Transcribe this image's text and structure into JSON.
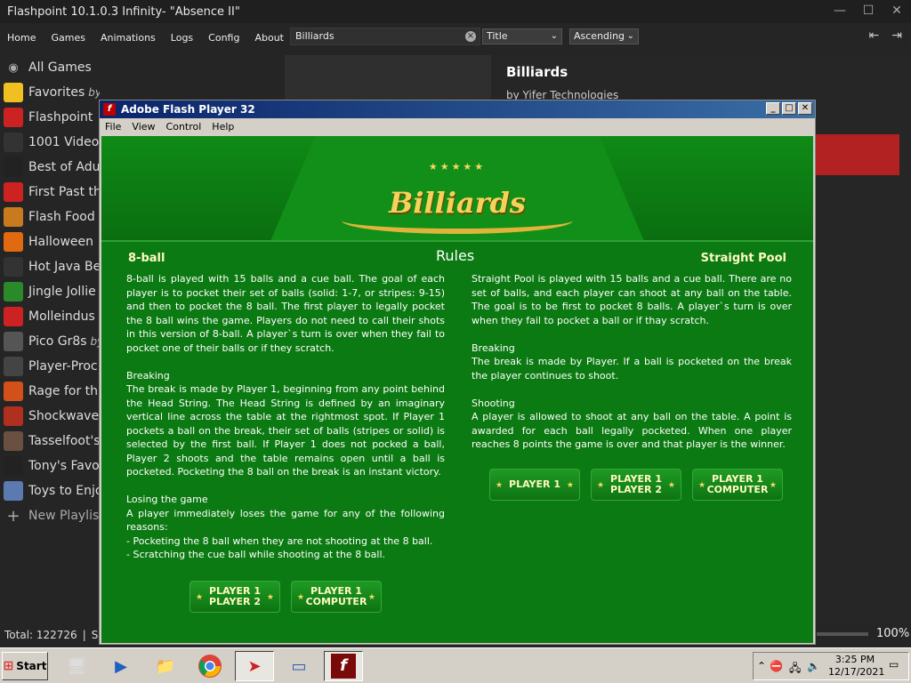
{
  "window": {
    "title": "Flashpoint 10.1.0.3 Infinity- \"Absence II\"",
    "min": "—",
    "max": "☐",
    "close": "✕"
  },
  "nav": {
    "items": [
      "Home",
      "Games",
      "Animations",
      "Logs",
      "Config",
      "About"
    ]
  },
  "search": {
    "value": "Billiards"
  },
  "sort": {
    "field": "Title",
    "order": "Ascending"
  },
  "sidebar": {
    "all_games": "All Games",
    "items": [
      {
        "label": "Favorites",
        "sub": "by You!",
        "icon": "star-icon",
        "color": "#f0c020"
      },
      {
        "label": "Flashpoint",
        "icon": "flashpoint-icon",
        "color": "#c22"
      },
      {
        "label": "1001 Video",
        "icon": "invader-icon",
        "color": "#333"
      },
      {
        "label": "Best of Adu",
        "icon": "as-icon",
        "color": "#222"
      },
      {
        "label": "First Past th",
        "icon": "number-one-icon",
        "color": "#c22"
      },
      {
        "label": "Flash Food",
        "icon": "burger-icon",
        "color": "#c87a1e"
      },
      {
        "label": "Halloween",
        "icon": "pumpkin-icon",
        "color": "#e06a10"
      },
      {
        "label": "Hot Java Be",
        "icon": "coffee-icon",
        "color": "#333"
      },
      {
        "label": "Jingle Jollie",
        "icon": "tree-icon",
        "color": "#2a8a2a"
      },
      {
        "label": "Molleindus",
        "icon": "mollein-icon",
        "color": "#c22"
      },
      {
        "label": "Pico Gr8s",
        "sub": "by",
        "icon": "pixel-icon",
        "color": "#555"
      },
      {
        "label": "Player-Proc",
        "icon": "share-icon",
        "color": "#444"
      },
      {
        "label": "Rage for th",
        "icon": "fire-icon",
        "color": "#d4501a"
      },
      {
        "label": "Shockwave",
        "icon": "shockwave-icon",
        "color": "#b03020"
      },
      {
        "label": "Tasselfoot's",
        "icon": "avatar-icon",
        "color": "#6a5040"
      },
      {
        "label": "Tony's Favo",
        "icon": "figure-icon",
        "color": "#222"
      },
      {
        "label": "Toys to Enjo",
        "icon": "toys-icon",
        "color": "#5a7ab0"
      }
    ],
    "new_playlist": "New Playlis"
  },
  "detail": {
    "title": "Billiards",
    "by": "by Yifer Technologies"
  },
  "status": {
    "total": "Total: 122726",
    "sep": "|",
    "se": "Se",
    "zoom": "100%"
  },
  "flash": {
    "title": "Adobe Flash Player 32",
    "menu": [
      "File",
      "View",
      "Control",
      "Help"
    ],
    "game": {
      "logo": "Billiards",
      "stars": "★★★★★",
      "rules": "Rules",
      "left_heading": "8-ball",
      "right_heading": "Straight Pool",
      "left_paragraphs": [
        "8-ball is played with 15 balls and a cue ball. The goal of each player is to pocket their set of balls (solid: 1-7, or stripes: 9-15) and then to pocket the 8 ball. The first player to legally pocket the 8 ball wins the game. Players do not need to call their shots in this version of 8-ball. A player`s turn is over when they fail to pocket one of their balls or if they scratch.",
        "Breaking\nThe break is made by Player 1, beginning from any point behind the Head String. The Head String is defined by an imaginary vertical line across the table at the rightmost spot. If Player 1 pockets a ball on the break, their set of balls (stripes or solid) is selected by the first ball. If Player 1 does not pocked a ball, Player 2 shoots and the table remains open until a ball is pocketed. Pocketing the 8 ball on the break is an instant victory.",
        "Losing the game\nA player immediately loses the game for any of the following reasons:\n- Pocketing the 8 ball when they are not shooting at the 8 ball.\n- Scratching the cue ball while shooting at the 8 ball."
      ],
      "right_paragraphs": [
        "Straight Pool is played with 15 balls and a cue ball. There are no set of balls, and each player can shoot at any ball on the table. The goal is to be first to pocket 8 balls. A player`s turn is over when they fail to pocket a ball or if thay scratch.",
        "Breaking\nThe break is made by Player. If a ball is pocketed on the break the player continues to shoot.",
        "Shooting\nA player is allowed to shoot at any ball on the table. A point is awarded for each ball legally pocketed. When one player reaches 8 points the game is over and that player is the winner."
      ],
      "buttons_left": [
        {
          "l1": "PLAYER 1",
          "l2": "PLAYER 2"
        },
        {
          "l1": "PLAYER 1",
          "l2": "COMPUTER"
        }
      ],
      "buttons_right": [
        {
          "l1": "PLAYER 1",
          "l2": ""
        },
        {
          "l1": "PLAYER 1",
          "l2": "PLAYER 2"
        },
        {
          "l1": "PLAYER 1",
          "l2": "COMPUTER"
        }
      ]
    }
  },
  "taskbar": {
    "start": "Start",
    "time": "3:25 PM",
    "date": "12/17/2021"
  }
}
